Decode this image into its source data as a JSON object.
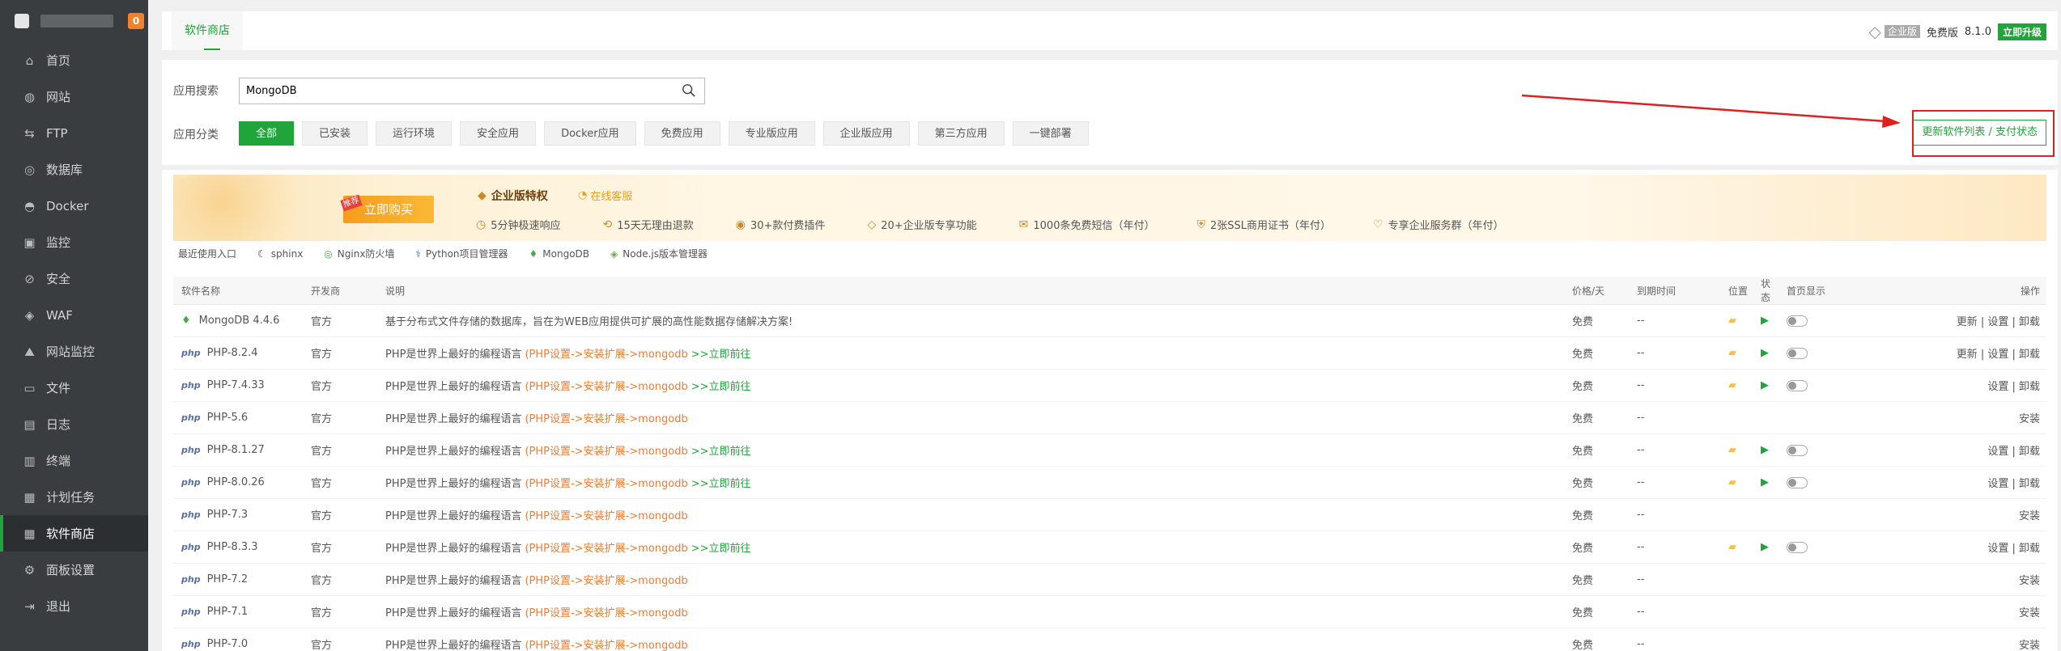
{
  "sidebar": {
    "badge": "0",
    "items": [
      {
        "label": "首页",
        "icon": "home-icon",
        "glyph": "⌂"
      },
      {
        "label": "网站",
        "icon": "globe-icon",
        "glyph": "◍"
      },
      {
        "label": "FTP",
        "icon": "ftp-icon",
        "glyph": "⇆"
      },
      {
        "label": "数据库",
        "icon": "database-icon",
        "glyph": "◎"
      },
      {
        "label": "Docker",
        "icon": "docker-icon",
        "glyph": "◓"
      },
      {
        "label": "监控",
        "icon": "monitor-icon",
        "glyph": "▣"
      },
      {
        "label": "安全",
        "icon": "shield-icon",
        "glyph": "⊘"
      },
      {
        "label": "WAF",
        "icon": "waf-icon",
        "glyph": "◈"
      },
      {
        "label": "网站监控",
        "icon": "chart-icon",
        "glyph": "⛰"
      },
      {
        "label": "文件",
        "icon": "folder-icon",
        "glyph": "▭"
      },
      {
        "label": "日志",
        "icon": "log-icon",
        "glyph": "▤"
      },
      {
        "label": "终端",
        "icon": "terminal-icon",
        "glyph": "▥"
      },
      {
        "label": "计划任务",
        "icon": "task-icon",
        "glyph": "▦"
      },
      {
        "label": "软件商店",
        "icon": "apps-icon",
        "glyph": "▦"
      },
      {
        "label": "面板设置",
        "icon": "settings-icon",
        "glyph": "⚙"
      },
      {
        "label": "退出",
        "icon": "logout-icon",
        "glyph": "⇥"
      }
    ]
  },
  "topbar": {
    "tab": "软件商店",
    "edition_tag": "企业版",
    "free_label": "免费版",
    "version": "8.1.0",
    "upgrade": "立即升级"
  },
  "search": {
    "label": "应用搜索",
    "value": "MongoDB",
    "category_label": "应用分类",
    "categories": [
      "全部",
      "已安装",
      "运行环境",
      "安全应用",
      "Docker应用",
      "免费应用",
      "专业版应用",
      "企业版应用",
      "第三方应用",
      "一键部署"
    ],
    "update_button": "更新软件列表 / 支付状态"
  },
  "banner": {
    "buy": "立即购买",
    "buy_tag": "推荐",
    "title": "企业版特权",
    "service": "在线客服",
    "features": [
      "5分钟极速响应",
      "15天无理由退款",
      "30+款付费插件",
      "20+企业版专享功能",
      "1000条免费短信（年付）",
      "2张SSL商用证书（年付）",
      "专享企业服务群（年付）"
    ]
  },
  "recent": {
    "label": "最近使用入口",
    "items": [
      "sphinx",
      "Nginx防火墙",
      "Python项目管理器",
      "MongoDB",
      "Node.js版本管理器"
    ]
  },
  "table": {
    "headers": [
      "软件名称",
      "开发商",
      "说明",
      "价格/天",
      "到期时间",
      "位置",
      "状态",
      "首页显示",
      "操作"
    ],
    "rows": [
      {
        "name": "MongoDB 4.4.6",
        "dev": "官方",
        "desc": "基于分布式文件存储的数据库，旨在为WEB应用提供可扩展的高性能数据存储解决方案!",
        "hint": "",
        "go": "",
        "price": "免费",
        "expire": "--",
        "installed": true,
        "ops": "更新 | 设置 | 卸载"
      },
      {
        "name": "PHP-8.2.4",
        "dev": "官方",
        "desc": "PHP是世界上最好的编程语言",
        "hint": "(PHP设置->安装扩展->mongodb",
        "go": ">>立即前往",
        "price": "免费",
        "expire": "--",
        "installed": true,
        "ops": "更新 | 设置 | 卸载"
      },
      {
        "name": "PHP-7.4.33",
        "dev": "官方",
        "desc": "PHP是世界上最好的编程语言",
        "hint": "(PHP设置->安装扩展->mongodb",
        "go": ">>立即前往",
        "price": "免费",
        "expire": "--",
        "installed": true,
        "ops": "设置 | 卸载"
      },
      {
        "name": "PHP-5.6",
        "dev": "官方",
        "desc": "PHP是世界上最好的编程语言",
        "hint": "(PHP设置->安装扩展->mongodb",
        "go": "",
        "price": "免费",
        "expire": "--",
        "installed": false,
        "ops": "安装"
      },
      {
        "name": "PHP-8.1.27",
        "dev": "官方",
        "desc": "PHP是世界上最好的编程语言",
        "hint": "(PHP设置->安装扩展->mongodb",
        "go": ">>立即前往",
        "price": "免费",
        "expire": "--",
        "installed": true,
        "ops": "设置 | 卸载"
      },
      {
        "name": "PHP-8.0.26",
        "dev": "官方",
        "desc": "PHP是世界上最好的编程语言",
        "hint": "(PHP设置->安装扩展->mongodb",
        "go": ">>立即前往",
        "price": "免费",
        "expire": "--",
        "installed": true,
        "ops": "设置 | 卸载"
      },
      {
        "name": "PHP-7.3",
        "dev": "官方",
        "desc": "PHP是世界上最好的编程语言",
        "hint": "(PHP设置->安装扩展->mongodb",
        "go": "",
        "price": "免费",
        "expire": "--",
        "installed": false,
        "ops": "安装"
      },
      {
        "name": "PHP-8.3.3",
        "dev": "官方",
        "desc": "PHP是世界上最好的编程语言",
        "hint": "(PHP设置->安装扩展->mongodb",
        "go": ">>立即前往",
        "price": "免费",
        "expire": "--",
        "installed": true,
        "ops": "设置 | 卸载"
      },
      {
        "name": "PHP-7.2",
        "dev": "官方",
        "desc": "PHP是世界上最好的编程语言",
        "hint": "(PHP设置->安装扩展->mongodb",
        "go": "",
        "price": "免费",
        "expire": "--",
        "installed": false,
        "ops": "安装"
      },
      {
        "name": "PHP-7.1",
        "dev": "官方",
        "desc": "PHP是世界上最好的编程语言",
        "hint": "(PHP设置->安装扩展->mongodb",
        "go": "",
        "price": "免费",
        "expire": "--",
        "installed": false,
        "ops": "安装"
      },
      {
        "name": "PHP-7.0",
        "dev": "官方",
        "desc": "PHP是世界上最好的编程语言",
        "hint": "(PHP设置->安装扩展->mongodb",
        "go": "",
        "price": "免费",
        "expire": "--",
        "installed": false,
        "ops": "安装"
      }
    ]
  },
  "colors": {
    "accent": "#20a53a",
    "sidebar": "#3a3d40",
    "highlight": "#f17b2d",
    "annotation": "#e02020"
  }
}
